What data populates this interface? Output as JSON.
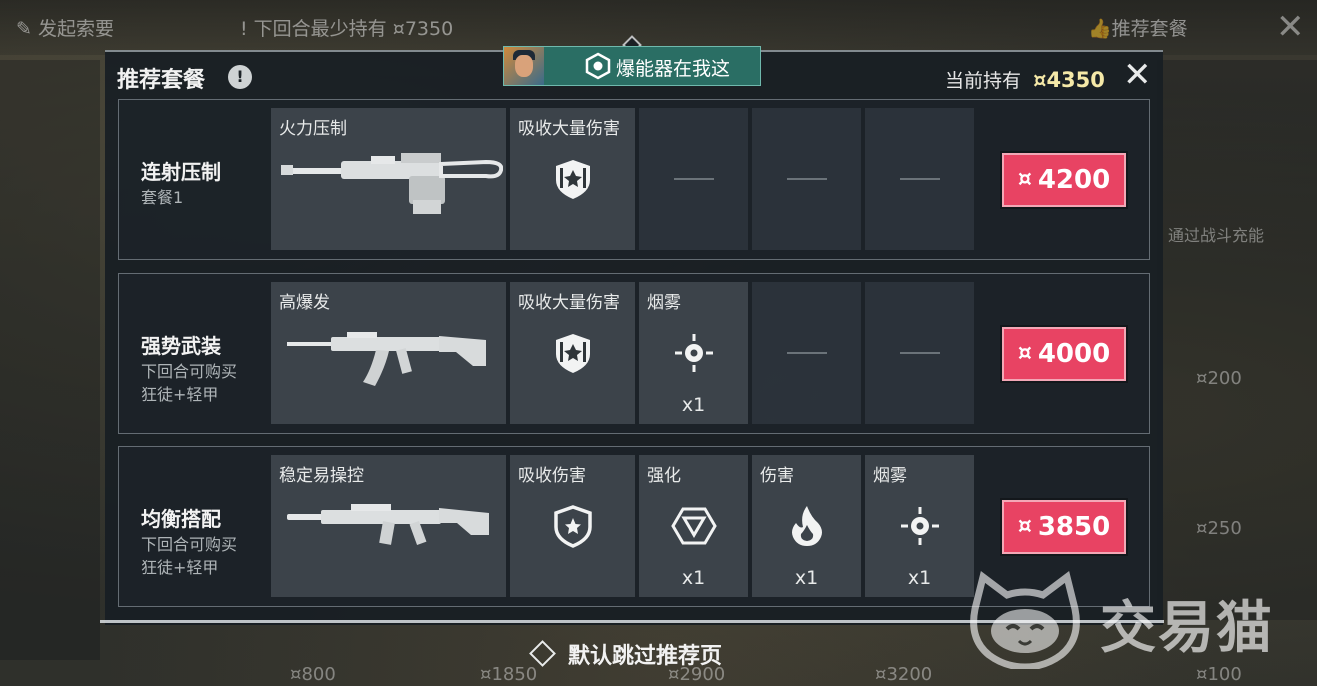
{
  "background": {
    "top_left": "发起索要",
    "top_mid_prefix": "下回合最少持有",
    "top_mid_amount": "7350",
    "top_right": "推荐套餐",
    "right_panel_text": "通过战斗充能",
    "right_prices": [
      "200",
      "250",
      "100"
    ],
    "bottom_prices": [
      "800",
      "1850",
      "2900",
      "3200"
    ]
  },
  "modal": {
    "title": "推荐套餐",
    "info_icon": "!",
    "holding_label": "当前持有",
    "holding_amount": "4350",
    "close_icon": "close-icon"
  },
  "banner": {
    "text": "爆能器在我这",
    "icon": "spike-icon"
  },
  "packages": [
    {
      "name": "连射压制",
      "sub": [
        "套餐1"
      ],
      "weapon_label": "火力压制",
      "weapon_icon": "machine-gun",
      "items": [
        {
          "label": "吸收大量伤害",
          "icon": "heavy-shield-icon",
          "count": ""
        },
        {
          "label": "",
          "icon": "",
          "count": ""
        },
        {
          "label": "",
          "icon": "",
          "count": ""
        },
        {
          "label": "",
          "icon": "",
          "count": ""
        }
      ],
      "price": "4200"
    },
    {
      "name": "强势武装",
      "sub": [
        "下回合可购买",
        "狂徒+轻甲"
      ],
      "weapon_label": "高爆发",
      "weapon_icon": "assault-rifle",
      "items": [
        {
          "label": "吸收大量伤害",
          "icon": "heavy-shield-icon",
          "count": ""
        },
        {
          "label": "烟雾",
          "icon": "smoke-icon",
          "count": "x1"
        },
        {
          "label": "",
          "icon": "",
          "count": ""
        },
        {
          "label": "",
          "icon": "",
          "count": ""
        }
      ],
      "price": "4000"
    },
    {
      "name": "均衡搭配",
      "sub": [
        "下回合可购买",
        "狂徒+轻甲"
      ],
      "weapon_label": "稳定易操控",
      "weapon_icon": "rifle",
      "items": [
        {
          "label": "吸收伤害",
          "icon": "light-shield-icon",
          "count": ""
        },
        {
          "label": "强化",
          "icon": "buff-icon",
          "count": "x1"
        },
        {
          "label": "伤害",
          "icon": "fire-icon",
          "count": "x1"
        },
        {
          "label": "烟雾",
          "icon": "smoke-icon",
          "count": "x1"
        }
      ],
      "price": "3850"
    }
  ],
  "footer": {
    "text": "默认跳过推荐页"
  },
  "watermark": {
    "text": "交易猫"
  },
  "colors": {
    "buy_button": "#e84363",
    "banner": "#2a6e64",
    "holding_amount": "#f5e9a8"
  }
}
